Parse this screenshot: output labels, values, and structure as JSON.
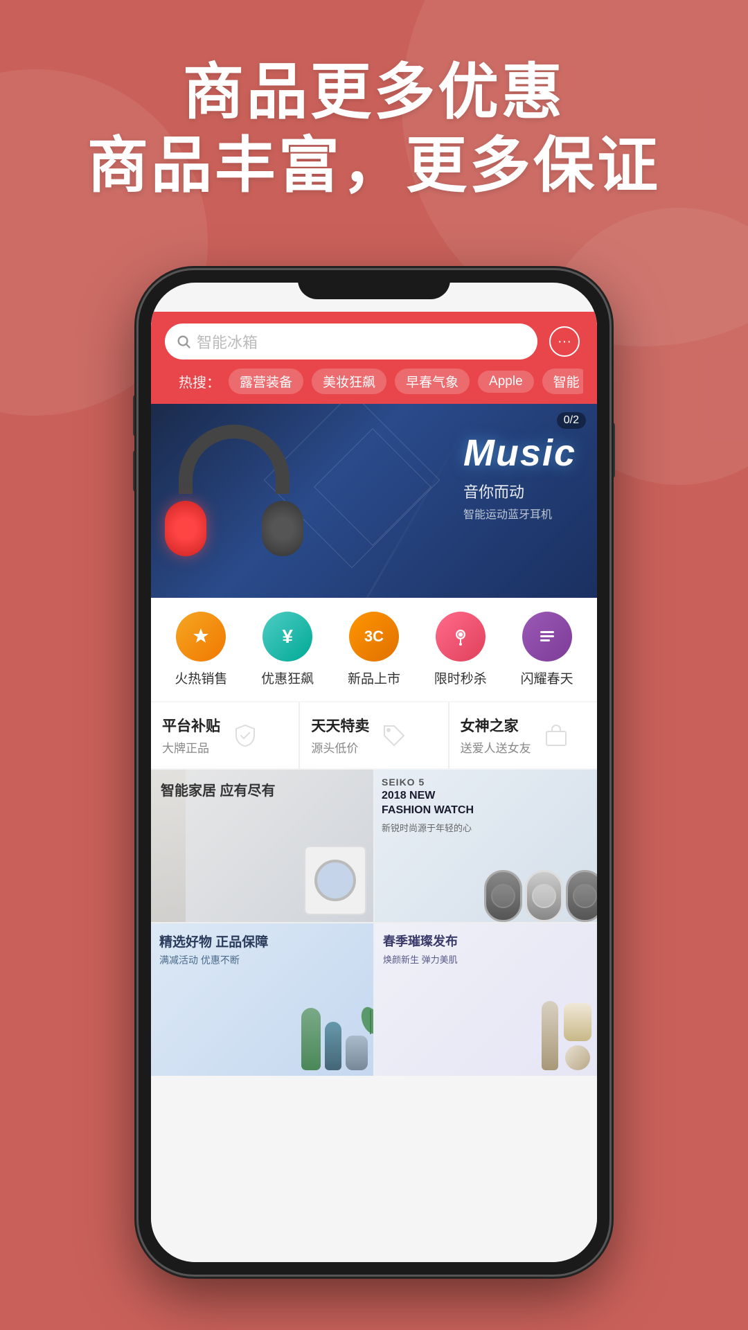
{
  "background": {
    "color": "#c9615a"
  },
  "hero": {
    "line1": "商品更多优惠",
    "line2": "商品丰富，更多保证"
  },
  "search": {
    "placeholder": "智能冰箱",
    "icon": "search-icon",
    "chat_icon": "···"
  },
  "hot_search": {
    "label": "热搜：",
    "tags": [
      "露营装备",
      "美妆狂飙",
      "早春气象",
      "Apple",
      "智能"
    ]
  },
  "banner": {
    "title": "Music",
    "subtitle": "音你而动",
    "sub2": "智能运动蓝牙耳机",
    "counter": "0/2"
  },
  "categories": [
    {
      "label": "火热销售",
      "icon": "↓",
      "color": "cat-orange"
    },
    {
      "label": "优惠狂飙",
      "icon": "¥",
      "color": "cat-green"
    },
    {
      "label": "新品上市",
      "icon": "3C",
      "color": "cat-orange2"
    },
    {
      "label": "限时秒杀",
      "icon": "★",
      "color": "cat-salmon"
    },
    {
      "label": "闪耀春天",
      "icon": "≡",
      "color": "cat-purple"
    }
  ],
  "features": [
    {
      "title": "平台补贴",
      "sub": "大牌正品",
      "icon": "✓"
    },
    {
      "title": "天天特卖",
      "sub": "源头低价",
      "icon": "⬡"
    },
    {
      "title": "女神之家",
      "sub": "送爱人送女友",
      "icon": "⊡"
    }
  ],
  "products": [
    {
      "id": "smart-home",
      "title": "智能家居 应有尽有",
      "bg": "card-smart-home"
    },
    {
      "id": "watch",
      "brand": "SEIKO 5",
      "title": "2018 NEW FASHION WATCH",
      "sub": "新锐时尚源于年轻的心",
      "bg": "card-watch"
    },
    {
      "id": "cosmetics",
      "title": "精选好物 正品保障",
      "sub": "满减活动 优惠不断",
      "bg": "card-cosmetics"
    },
    {
      "id": "skincare",
      "title": "春季璀璨发布",
      "sub": "焕颜新生 弹力美肌",
      "bg": "card-skincare"
    }
  ]
}
